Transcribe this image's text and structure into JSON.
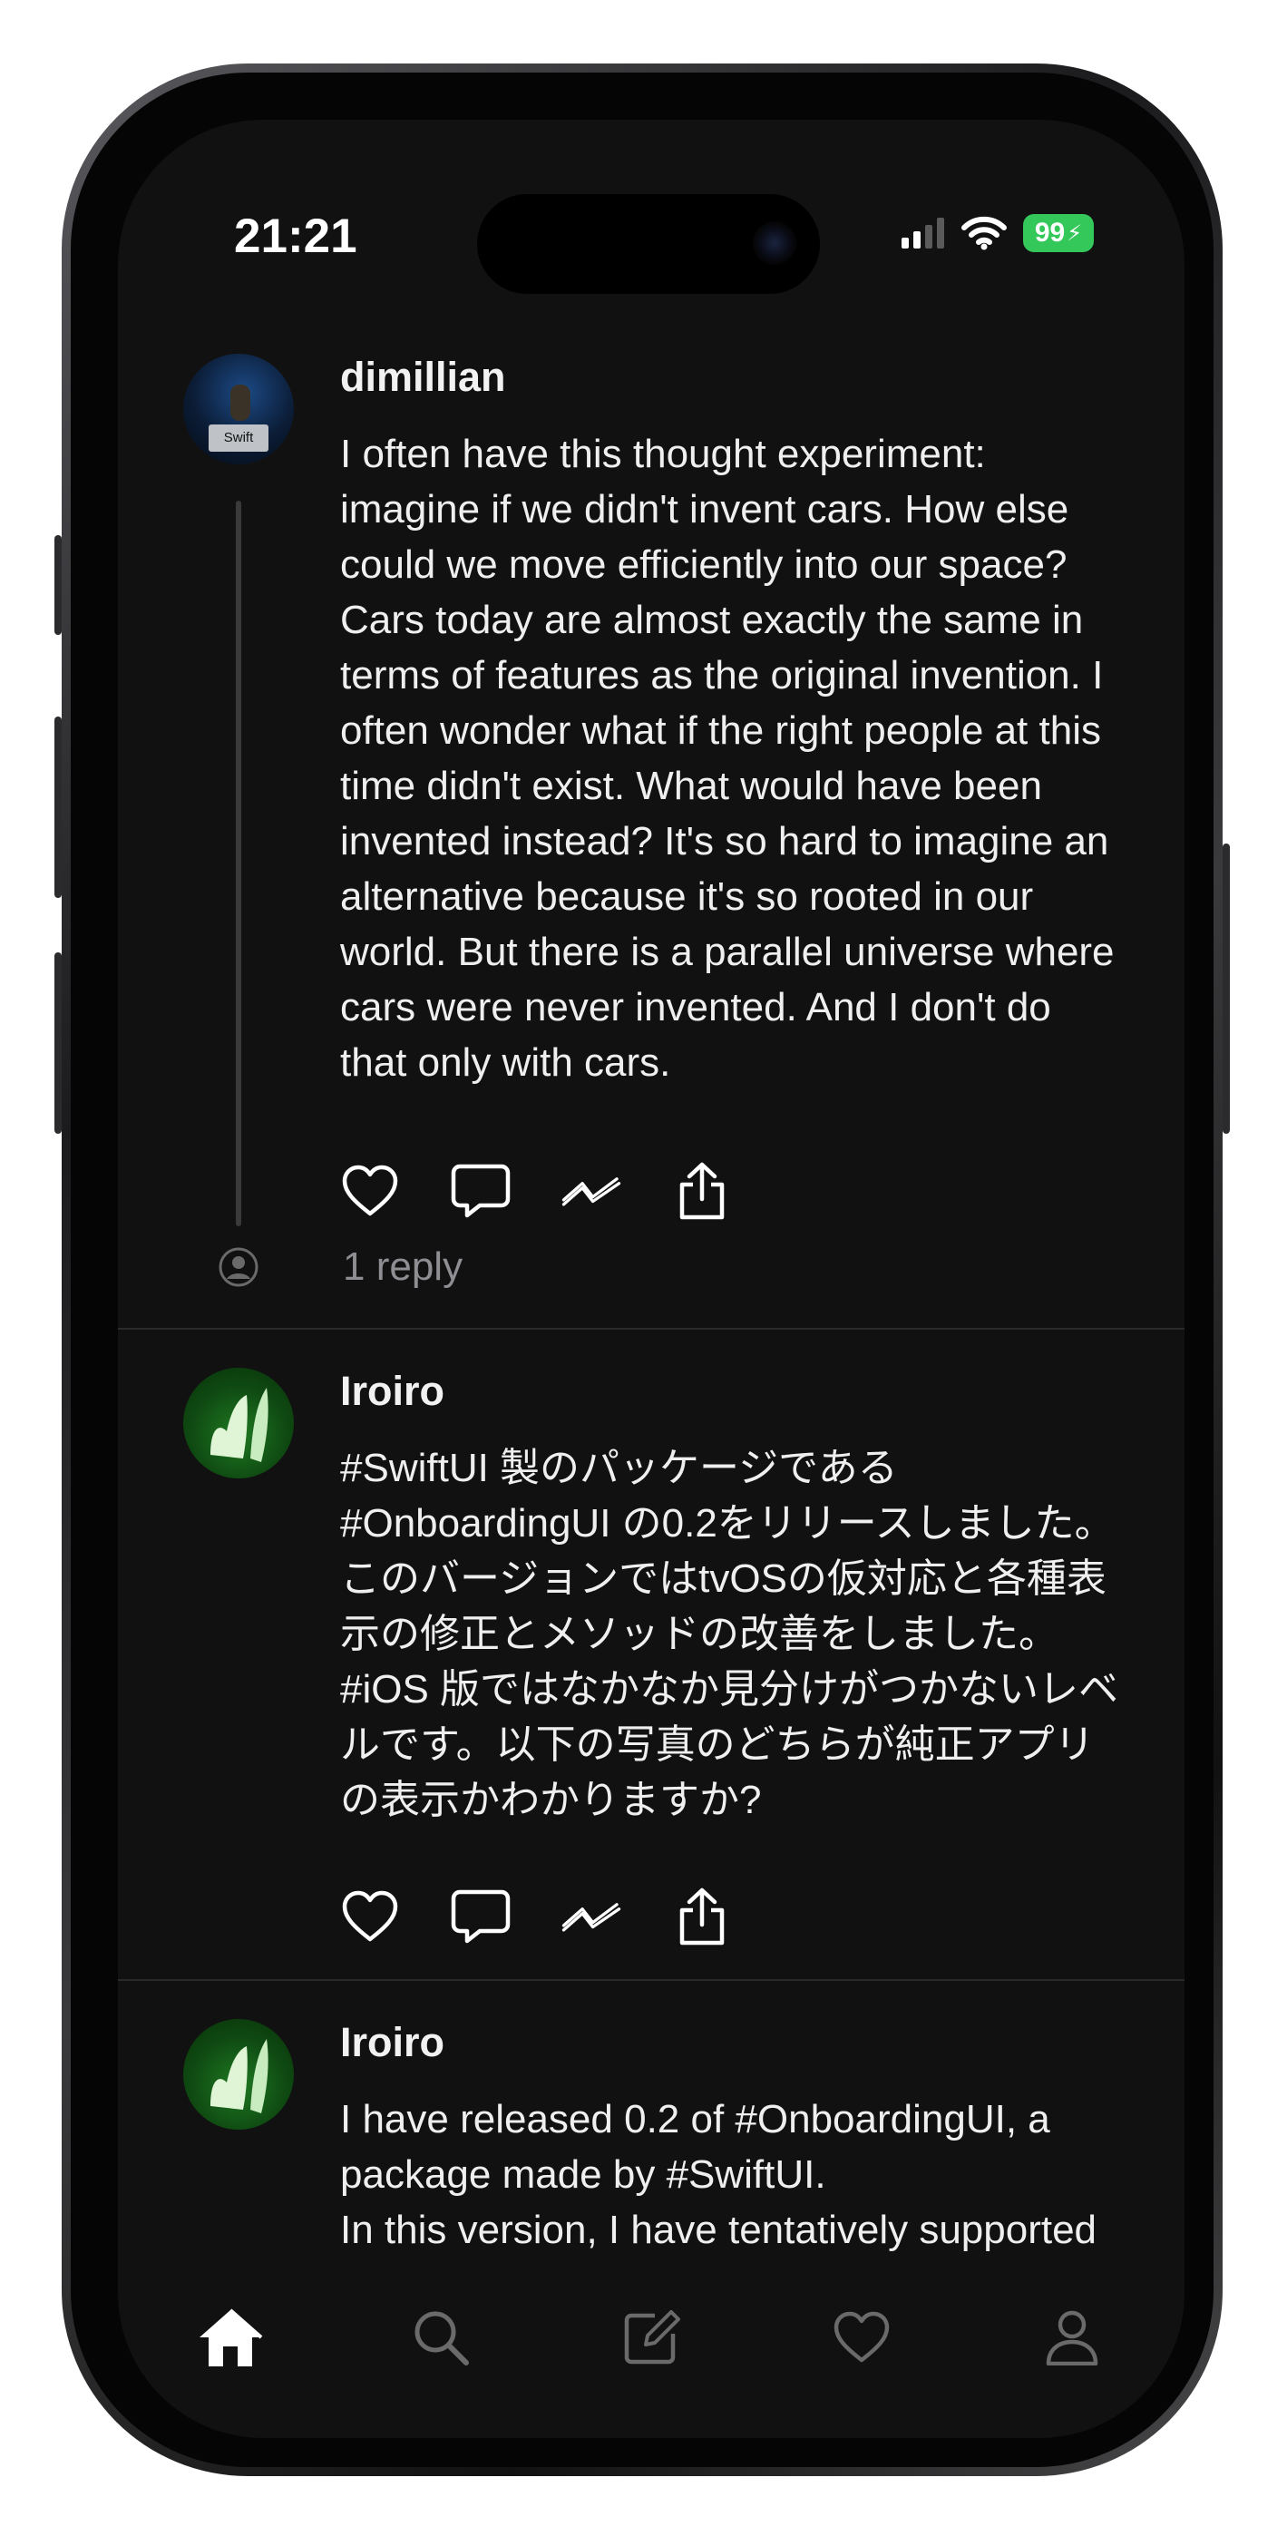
{
  "status_bar": {
    "time": "21:21",
    "battery": "99"
  },
  "posts": [
    {
      "username": "dimillian",
      "text": "I often have this thought experiment:\nimagine if we didn't invent cars. How else\ncould we move efficiently into our space?\nCars today are almost exactly the same in\nterms of features as the original invention. I\noften wonder what if the right people at this\ntime didn't exist. What would have been\ninvented instead? It's so hard to imagine an\nalternative because it's so rooted in our\nworld. But there is a parallel universe where\ncars were never invented. And I don't do\nthat only with cars.",
      "replies": "1 reply",
      "avatar_badge": "Swift"
    },
    {
      "username": "Iroiro",
      "text": "#SwiftUI 製のパッケージである\n#OnboardingUI の0.2をリリースしました。\nこのバージョンではtvOSの仮対応と各種表\n示の修正とメソッドの改善をしました。\n#iOS 版ではなかなか見分けがつかないレベ\nルです。以下の写真のどちらが純正アプリ\nの表示かわかりますか?"
    },
    {
      "username": "Iroiro",
      "text": "I have released 0.2 of #OnboardingUI, a\npackage made by #SwiftUI.\nIn this version, I have tentatively supported"
    }
  ],
  "icons": {
    "like": "heart-icon",
    "reply": "speech-bubble-icon",
    "repost": "zigzag-icon",
    "share": "share-icon"
  },
  "tabs": [
    "home-icon",
    "search-icon",
    "compose-icon",
    "activity-heart-icon",
    "profile-icon"
  ],
  "colors": {
    "background": "#111111",
    "text": "#efefef",
    "secondary": "#8e8e93",
    "battery": "#34c759"
  }
}
